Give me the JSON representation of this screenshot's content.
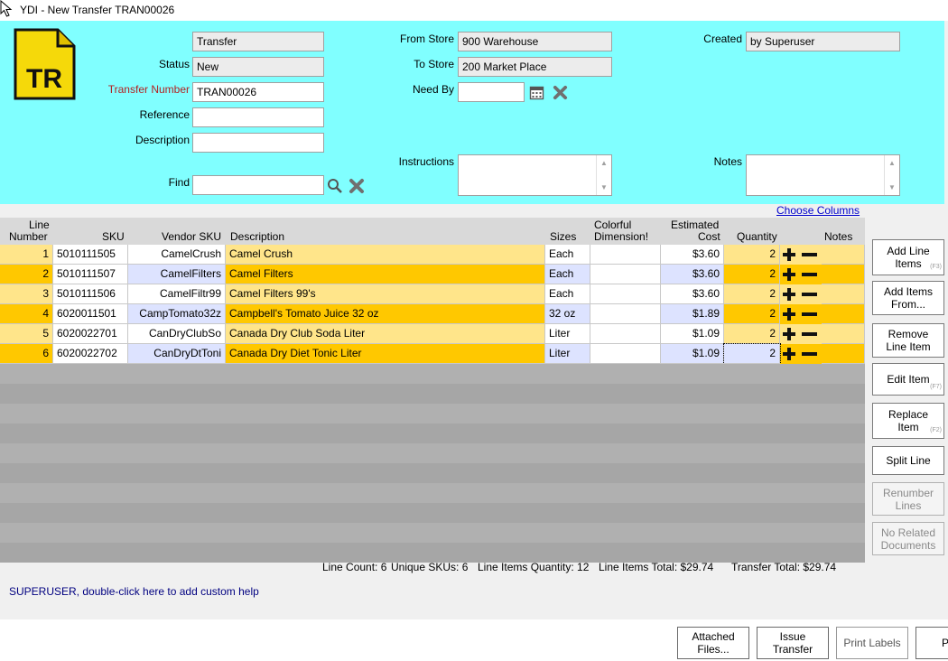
{
  "window": {
    "title": "YDI - New Transfer TRAN00026"
  },
  "header": {
    "logo_text": "TR",
    "type_value": "Transfer",
    "status_label": "Status",
    "status_value": "New",
    "transfer_number_label": "Transfer Number",
    "transfer_number_value": "TRAN00026",
    "reference_label": "Reference",
    "reference_value": "",
    "description_label": "Description",
    "description_value": "",
    "find_label": "Find",
    "find_value": "",
    "from_store_label": "From Store",
    "from_store_value": "900 Warehouse",
    "to_store_label": "To Store",
    "to_store_value": "200 Market Place",
    "need_by_label": "Need By",
    "need_by_value": "",
    "instructions_label": "Instructions",
    "created_label": "Created",
    "created_value": "by Superuser",
    "notes_label": "Notes"
  },
  "grid": {
    "choose_columns": "Choose Columns",
    "headers": {
      "line_1": "Line",
      "line_2": "Number",
      "sku": "SKU",
      "vendor_sku": "Vendor SKU",
      "description": "Description",
      "sizes": "Sizes",
      "colorful_1": "Colorful",
      "colorful_2": "Dimension!",
      "cost_1": "Estimated",
      "cost_2": "Cost",
      "quantity": "Quantity",
      "notes": "Notes"
    },
    "rows": [
      {
        "line": "1",
        "sku": "5010111505",
        "vendor_sku": "CamelCrush",
        "description": "Camel Crush",
        "size": "Each",
        "colorful": "",
        "cost": "$3.60",
        "qty": "2",
        "notes": ""
      },
      {
        "line": "2",
        "sku": "5010111507",
        "vendor_sku": "CamelFilters",
        "description": "Camel Filters",
        "size": "Each",
        "colorful": "",
        "cost": "$3.60",
        "qty": "2",
        "notes": ""
      },
      {
        "line": "3",
        "sku": "5010111506",
        "vendor_sku": "CamelFiltr99",
        "description": "Camel Filters 99's",
        "size": "Each",
        "colorful": "",
        "cost": "$3.60",
        "qty": "2",
        "notes": ""
      },
      {
        "line": "4",
        "sku": "6020011501",
        "vendor_sku": "CampTomato32z",
        "description": "Campbell's Tomato Juice  32 oz",
        "size": "32 oz",
        "colorful": "",
        "cost": "$1.89",
        "qty": "2",
        "notes": ""
      },
      {
        "line": "5",
        "sku": "6020022701",
        "vendor_sku": "CanDryClubSo",
        "description": "Canada Dry  Club Soda Liter",
        "size": "Liter",
        "colorful": "",
        "cost": "$1.09",
        "qty": "2",
        "notes": ""
      },
      {
        "line": "6",
        "sku": "6020022702",
        "vendor_sku": "CanDryDtToni",
        "description": "Canada Dry  Diet Tonic Liter",
        "size": "Liter",
        "colorful": "",
        "cost": "$1.09",
        "qty": "2",
        "notes": ""
      }
    ]
  },
  "side_buttons": {
    "add_line_items": [
      "Add Line",
      "Items"
    ],
    "add_line_items_key": "(F3)",
    "add_items_from": [
      "Add Items",
      "From..."
    ],
    "remove_line_item": [
      "Remove",
      "Line Item"
    ],
    "edit_item": "Edit Item",
    "edit_item_key": "(F7)",
    "replace_item": [
      "Replace",
      "Item"
    ],
    "replace_item_key": "(F2)",
    "split_line": "Split Line",
    "renumber_lines": [
      "Renumber",
      "Lines"
    ],
    "no_related_documents": [
      "No Related",
      "Documents"
    ]
  },
  "summary": {
    "line_count": "Line Count: 6",
    "unique_skus": "Unique SKUs: 6",
    "line_items_quantity": "Line Items Quantity: 12",
    "line_items_total": "Line Items Total: $29.74",
    "transfer_total": "Transfer Total: $29.74"
  },
  "help_text": "SUPERUSER, double-click here to add custom help",
  "bottom_buttons": {
    "attached_files": [
      "Attached",
      "Files..."
    ],
    "issue_transfer": [
      "Issue",
      "Transfer"
    ],
    "print_labels": "Print Labels",
    "partial": "P"
  },
  "colors": {
    "header_bg": "#80ffff",
    "row_light": "#ffe58a",
    "row_dark": "#ffc800",
    "grid_empty": "#a6a6a6",
    "label_red": "#b22222",
    "help_text": "#000080"
  }
}
